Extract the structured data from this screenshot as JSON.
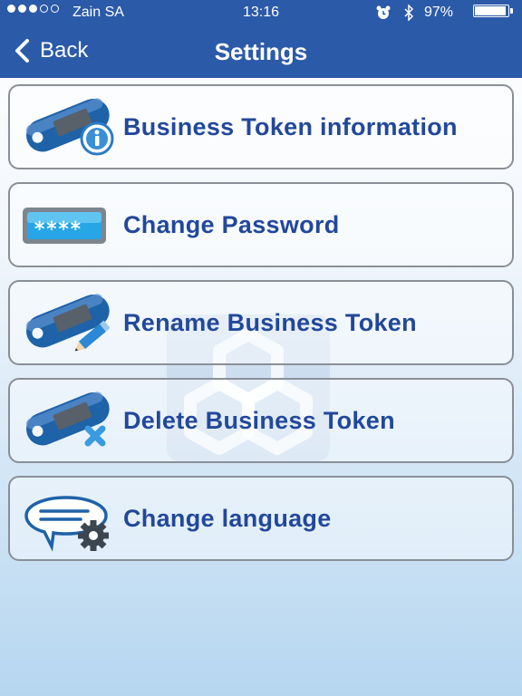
{
  "status_bar": {
    "carrier": "Zain SA",
    "time": "13:16",
    "battery_percent": "97%",
    "signal_strength": 3,
    "signal_total": 5
  },
  "nav": {
    "back_label": "Back",
    "title": "Settings"
  },
  "menu": [
    {
      "label": "Business Token information",
      "icon": "token-info-icon"
    },
    {
      "label": "Change Password",
      "icon": "password-field-icon"
    },
    {
      "label": "Rename Business Token",
      "icon": "token-rename-icon"
    },
    {
      "label": "Delete Business Token",
      "icon": "token-delete-icon"
    },
    {
      "label": "Change language",
      "icon": "language-settings-icon"
    }
  ],
  "colors": {
    "nav_background": "#2b5aa8",
    "label_text": "#22489a",
    "token_blue": "#1e62a8"
  }
}
